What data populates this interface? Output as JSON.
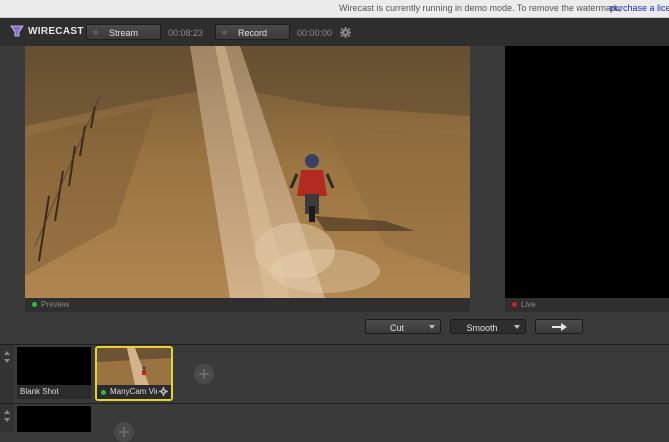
{
  "demo_notice": {
    "message": "Wirecast is currently running in demo mode. To remove the watermark,",
    "link": "purchase a license"
  },
  "toolbar": {
    "app_name": "WIRECAST",
    "stream_label": "Stream",
    "stream_time": "00:08:23",
    "record_label": "Record",
    "record_time": "00:00:00"
  },
  "monitors": {
    "preview_label": "Preview",
    "live_label": "Live"
  },
  "transition": {
    "cut_label": "Cut",
    "smooth_label": "Smooth"
  },
  "shots": [
    {
      "label": "Blank Shot"
    },
    {
      "label": "ManyCam Vir"
    }
  ],
  "colors": {
    "preview_dot": "#2dbf3a",
    "live_dot": "#d21f1f",
    "selected_border": "#e6d233"
  }
}
